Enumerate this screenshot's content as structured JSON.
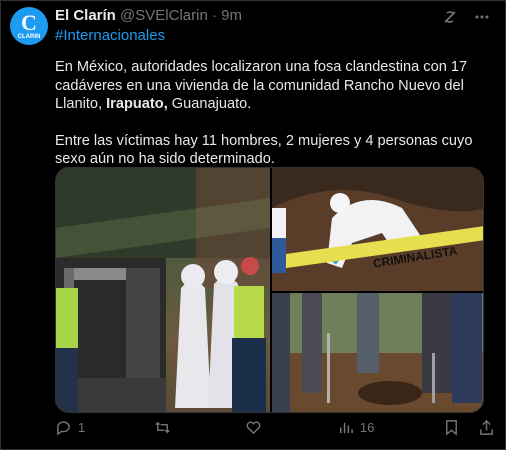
{
  "author": {
    "name": "El Clarín",
    "handle": "@SVElClarin",
    "separator": "·",
    "time": "9m",
    "avatar_letter": "C",
    "avatar_sub": "CLARIN",
    "avatar_color": "#1d9bf0"
  },
  "hashtag": "#Internacionales",
  "body": {
    "p1_part1": "En México, autoridades localizaron una fosa clandestina con 17 cadáveres en una vivienda de la comunidad Rancho Nuevo del Llanito, ",
    "p1_bold": "Irapuato,",
    "p1_part2": " Guanajuato.",
    "p2": "Entre las víctimas hay 11 hombres, 2 mujeres y 4 personas cuyo sexo aún no ha sido determinado."
  },
  "media": {
    "tape_text": "CRIMINALISTA"
  },
  "actions": {
    "replies": "1",
    "retweets": "",
    "likes": "",
    "views": "16"
  },
  "colors": {
    "background": "#000000",
    "text": "#e7e9ea",
    "muted": "#71767b",
    "link": "#1d9bf0"
  },
  "icons": [
    "grok-icon",
    "more-icon",
    "reply-icon",
    "retweet-icon",
    "like-icon",
    "views-icon",
    "bookmark-icon",
    "share-icon"
  ]
}
